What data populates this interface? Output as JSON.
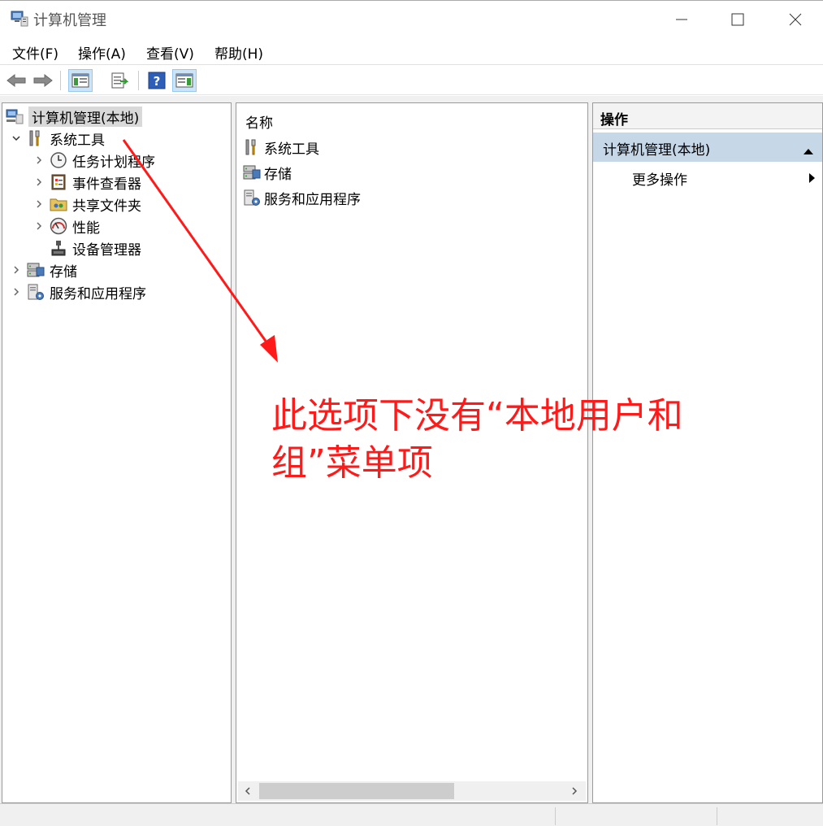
{
  "window": {
    "title": "计算机管理"
  },
  "menu": [
    {
      "label": "文件(F)"
    },
    {
      "label": "操作(A)"
    },
    {
      "label": "查看(V)"
    },
    {
      "label": "帮助(H)"
    }
  ],
  "toolbar": {
    "icons": [
      "back-icon",
      "forward-icon",
      "show-hide-console-tree-icon",
      "export-list-icon",
      "help-icon",
      "show-hide-action-pane-icon"
    ]
  },
  "tree": {
    "root": "计算机管理(本地)",
    "items": [
      {
        "label": "系统工具",
        "icon": "tools-icon"
      },
      {
        "label": "任务计划程序",
        "icon": "clock-icon"
      },
      {
        "label": "事件查看器",
        "icon": "event-viewer-icon"
      },
      {
        "label": "共享文件夹",
        "icon": "shared-folder-icon"
      },
      {
        "label": "性能",
        "icon": "performance-icon"
      },
      {
        "label": "设备管理器",
        "icon": "device-manager-icon"
      },
      {
        "label": "存储",
        "icon": "storage-icon"
      },
      {
        "label": "服务和应用程序",
        "icon": "services-icon"
      }
    ]
  },
  "list": {
    "column": "名称",
    "rows": [
      {
        "label": "系统工具"
      },
      {
        "label": "存储"
      },
      {
        "label": "服务和应用程序"
      }
    ]
  },
  "actions": {
    "header": "操作",
    "section": "计算机管理(本地)",
    "more": "更多操作"
  },
  "annotation": {
    "text_line1": "此选项下没有“本地用户和",
    "text_line2": "组”菜单项",
    "color": "#ff1a1a"
  }
}
